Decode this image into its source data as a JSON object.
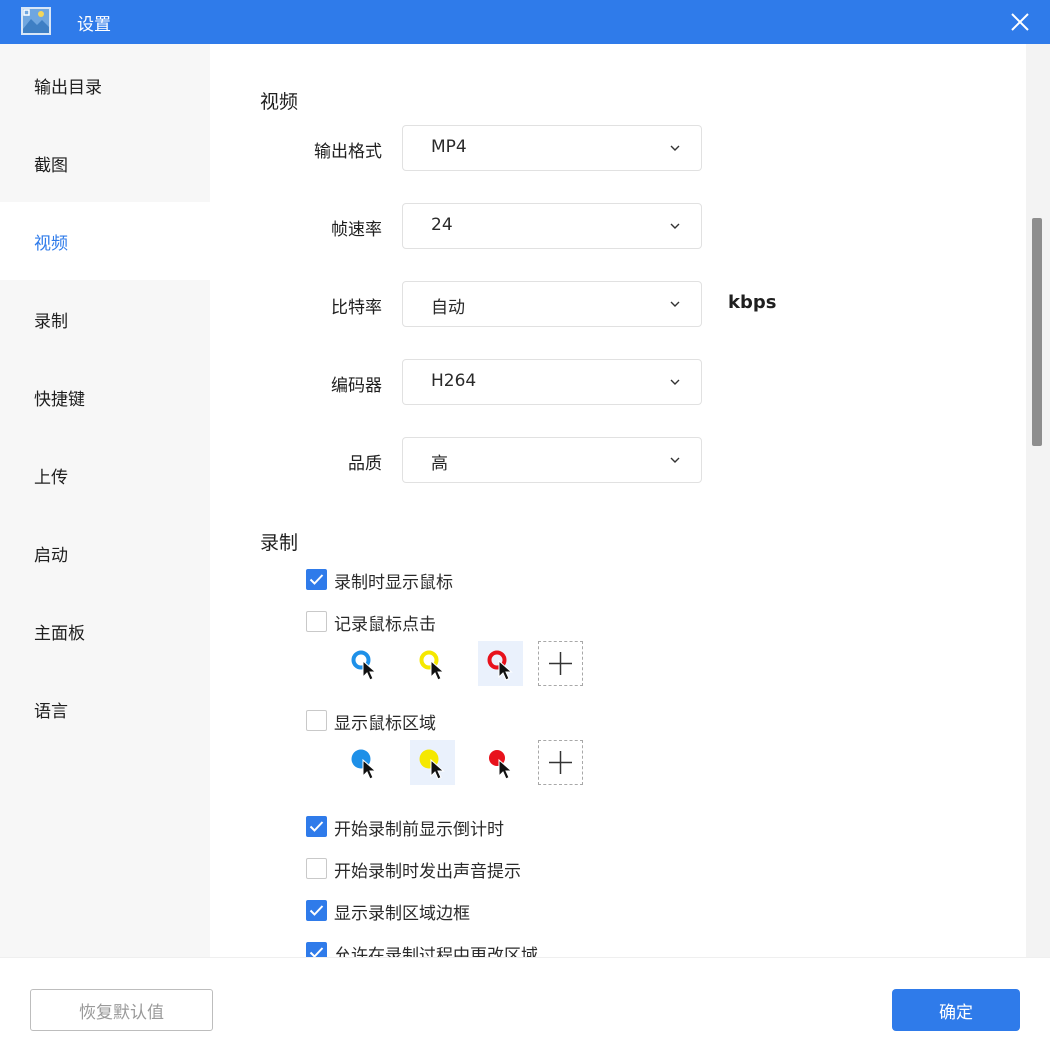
{
  "window": {
    "title": "设置",
    "app_icon": "screenshot-app-icon",
    "close_icon": "close-icon",
    "titlebar_color": "#2f7bea"
  },
  "sidebar": {
    "items": [
      {
        "label": "输出目录",
        "active": false
      },
      {
        "label": "截图",
        "active": false
      },
      {
        "label": "视频",
        "active": true
      },
      {
        "label": "录制",
        "active": false
      },
      {
        "label": "快捷键",
        "active": false
      },
      {
        "label": "上传",
        "active": false
      },
      {
        "label": "启动",
        "active": false
      },
      {
        "label": "主面板",
        "active": false
      },
      {
        "label": "语言",
        "active": false
      }
    ]
  },
  "video": {
    "title": "视频",
    "fields": [
      {
        "label": "输出格式",
        "value": "MP4"
      },
      {
        "label": "帧速率",
        "value": "24"
      },
      {
        "label": "比特率",
        "value": "自动",
        "unit": "kbps"
      },
      {
        "label": "编码器",
        "value": "H264"
      },
      {
        "label": "品质",
        "value": "高"
      }
    ]
  },
  "recording": {
    "title": "录制",
    "options": [
      {
        "label": "录制时显示鼠标",
        "checked": true
      },
      {
        "label": "记录鼠标点击",
        "checked": false
      },
      {
        "label": "显示鼠标区域",
        "checked": false
      },
      {
        "label": "开始录制前显示倒计时",
        "checked": true
      },
      {
        "label": "开始录制时发出声音提示",
        "checked": false
      },
      {
        "label": "显示录制区域边框",
        "checked": true
      },
      {
        "label": "允许在录制过程中更改区域",
        "checked": true
      }
    ],
    "click_styles": [
      {
        "name": "blue-ring-cursor-icon",
        "color": "#1e90e8",
        "selected": false
      },
      {
        "name": "yellow-ring-cursor-icon",
        "color": "#f5e800",
        "selected": false
      },
      {
        "name": "red-ring-cursor-icon",
        "color": "#e8121c",
        "selected": true
      }
    ],
    "area_styles": [
      {
        "name": "blue-dot-cursor-icon",
        "color": "#1e90e8",
        "selected": false
      },
      {
        "name": "yellow-dot-cursor-icon",
        "color": "#f5e800",
        "selected": true
      },
      {
        "name": "red-dot-cursor-icon",
        "color": "#e8121c",
        "selected": false
      }
    ],
    "add_icon": "plus-icon"
  },
  "footer": {
    "reset_label": "恢复默认值",
    "ok_label": "确定"
  },
  "colors": {
    "accent": "#2f7bea",
    "sidebar_bg": "#f7f7f7"
  }
}
